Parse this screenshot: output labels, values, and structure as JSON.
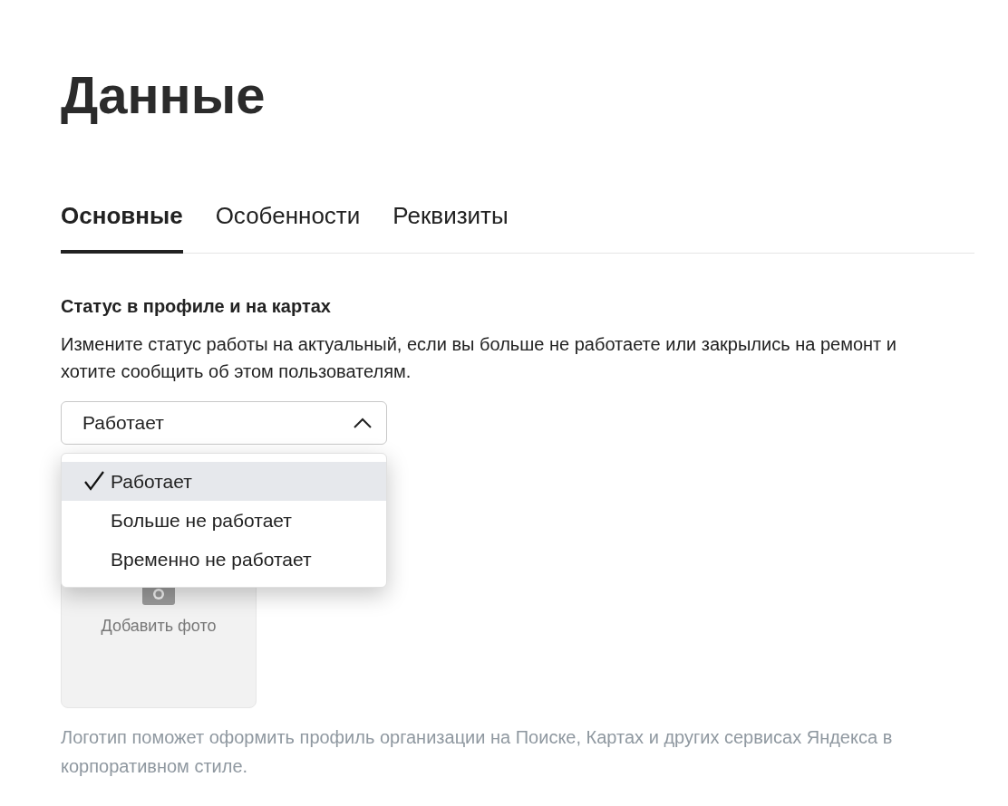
{
  "page_title": "Данные",
  "tabs": [
    {
      "label": "Основные",
      "selected": true
    },
    {
      "label": "Особенности",
      "selected": false
    },
    {
      "label": "Реквизиты",
      "selected": false
    }
  ],
  "status_section": {
    "heading": "Статус в профиле и на картах",
    "description": "Измените статус работы на актуальный, если вы больше не работаете или закрылись на ремонт и хотите сообщить об этом пользователям.",
    "select": {
      "value": "Работает",
      "expanded": true
    },
    "options": [
      {
        "label": "Работает",
        "selected": true
      },
      {
        "label": "Больше не работает",
        "selected": false
      },
      {
        "label": "Временно не работает",
        "selected": false
      }
    ]
  },
  "logo_section": {
    "add_photo_label": "Добавить фото",
    "hint": "Логотип поможет оформить профиль организации на Поиске, Картах и других сервисах Яндекса в корпоративном стиле."
  }
}
